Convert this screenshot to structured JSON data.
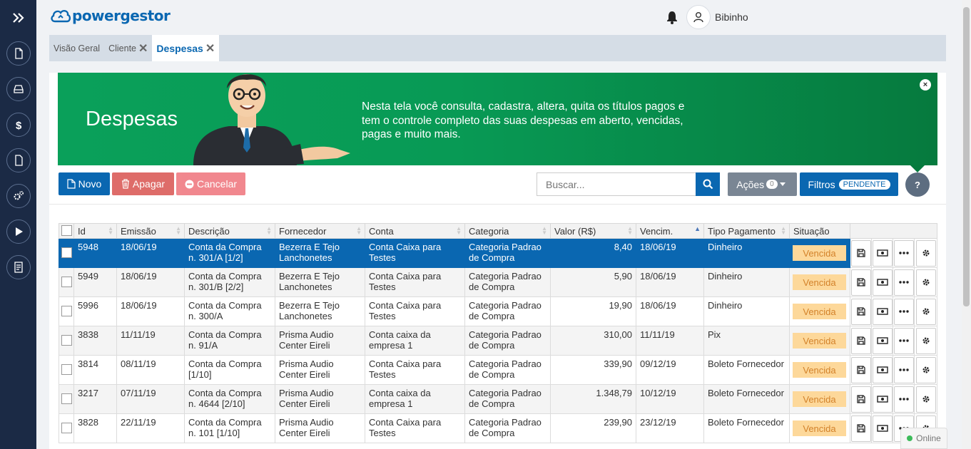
{
  "app": {
    "logo": "powergestor",
    "user": "Bibinho"
  },
  "sidebar": {
    "items": [
      {
        "icon": "expand-icon"
      },
      {
        "icon": "document-icon"
      },
      {
        "icon": "drive-icon"
      },
      {
        "icon": "dollar-icon"
      },
      {
        "icon": "file-icon"
      },
      {
        "icon": "gears-icon"
      },
      {
        "icon": "play-icon"
      },
      {
        "icon": "report-icon"
      }
    ]
  },
  "tabs": [
    {
      "label": "Visão Geral",
      "closable": false
    },
    {
      "label": "Cliente",
      "closable": true
    },
    {
      "label": "Despesas",
      "closable": true,
      "active": true
    }
  ],
  "banner": {
    "title": "Despesas",
    "text": "Nesta tela você consulta, cadastra, altera, quita os títulos pagos e tem o controle completo das suas despesas em aberto, vencidas, pagas e muito mais.",
    "close": "×"
  },
  "toolbar": {
    "novo": "Novo",
    "apagar": "Apagar",
    "cancelar": "Cancelar",
    "search_placeholder": "Buscar...",
    "acoes": "Ações",
    "acoes_count": "0",
    "filtros": "Filtros",
    "filtros_badge": "PENDENTE",
    "help": "?"
  },
  "table": {
    "headers": [
      "Id",
      "Emissão",
      "Descrição",
      "Fornecedor",
      "Conta",
      "Categoria",
      "Valor (R$)",
      "Vencim.",
      "Tipo Pagamento",
      "Situação"
    ],
    "rows": [
      {
        "id": "5948",
        "emissao": "18/06/19",
        "descricao": "Conta da Compra n. 301/A [1/2]",
        "fornecedor": "Bezerra E Tejo Lanchonetes",
        "conta": "Conta Caixa para Testes",
        "categoria": "Categoria Padrao de Compra",
        "valor": "8,40",
        "vencim": "18/06/19",
        "tipo": "Dinheiro",
        "situacao": "Vencida",
        "selected": true
      },
      {
        "id": "5949",
        "emissao": "18/06/19",
        "descricao": "Conta da Compra n. 301/B [2/2]",
        "fornecedor": "Bezerra E Tejo Lanchonetes",
        "conta": "Conta Caixa para Testes",
        "categoria": "Categoria Padrao de Compra",
        "valor": "5,90",
        "vencim": "18/06/19",
        "tipo": "Dinheiro",
        "situacao": "Vencida"
      },
      {
        "id": "5996",
        "emissao": "18/06/19",
        "descricao": "Conta da Compra n. 300/A",
        "fornecedor": "Bezerra E Tejo Lanchonetes",
        "conta": "Conta Caixa para Testes",
        "categoria": "Categoria Padrao de Compra",
        "valor": "19,90",
        "vencim": "18/06/19",
        "tipo": "Dinheiro",
        "situacao": "Vencida"
      },
      {
        "id": "3838",
        "emissao": "11/11/19",
        "descricao": "Conta da Compra n. 91/A",
        "fornecedor": "Prisma Audio Center Eireli",
        "conta": "Conta caixa da empresa 1",
        "categoria": "Categoria Padrao de Compra",
        "valor": "310,00",
        "vencim": "11/11/19",
        "tipo": "Pix",
        "situacao": "Vencida"
      },
      {
        "id": "3814",
        "emissao": "08/11/19",
        "descricao": "Conta da Compra [1/10]",
        "fornecedor": "Prisma Audio Center Eireli",
        "conta": "Conta Caixa para Testes",
        "categoria": "Categoria Padrao de Compra",
        "valor": "339,90",
        "vencim": "09/12/19",
        "tipo": "Boleto Fornecedor",
        "situacao": "Vencida"
      },
      {
        "id": "3217",
        "emissao": "07/11/19",
        "descricao": "Conta da Compra n. 4644 [2/10]",
        "fornecedor": "Prisma Audio Center Eireli",
        "conta": "Conta caixa da empresa 1",
        "categoria": "Categoria Padrao de Compra",
        "valor": "1.348,79",
        "vencim": "10/12/19",
        "tipo": "Boleto Fornecedor",
        "situacao": "Vencida"
      },
      {
        "id": "3828",
        "emissao": "22/11/19",
        "descricao": "Conta da Compra n. 101 [1/10]",
        "fornecedor": "Prisma Audio Center Eireli",
        "conta": "Conta Caixa para Testes",
        "categoria": "Categoria Padrao de Compra",
        "valor": "239,90",
        "vencim": "23/12/19",
        "tipo": "Boleto Fornecedor",
        "situacao": "Vencida"
      }
    ]
  },
  "status": {
    "online": "Online"
  },
  "colors": {
    "primary": "#0a67b1",
    "sidebar": "#1b2a45",
    "banner": "#089a55",
    "vencida_bg": "#fdd89a"
  }
}
